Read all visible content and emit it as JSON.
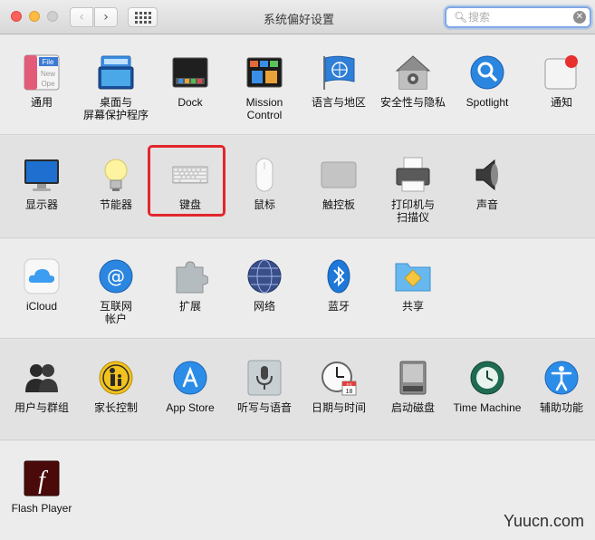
{
  "window": {
    "title": "系统偏好设置",
    "back_glyph": "‹",
    "forward_glyph": "›"
  },
  "search": {
    "placeholder": "搜索",
    "value": ""
  },
  "rows": [
    [
      {
        "label": "通用",
        "icon": "general-icon"
      },
      {
        "label": "桌面与\n屏幕保护程序",
        "icon": "desktop-screensaver-icon"
      },
      {
        "label": "Dock",
        "icon": "dock-icon"
      },
      {
        "label": "Mission\nControl",
        "icon": "mission-control-icon"
      },
      {
        "label": "语言与地区",
        "icon": "language-region-icon"
      },
      {
        "label": "安全性与隐私",
        "icon": "security-privacy-icon"
      },
      {
        "label": "Spotlight",
        "icon": "spotlight-icon"
      },
      {
        "label": "通知",
        "icon": "notifications-icon"
      }
    ],
    [
      {
        "label": "显示器",
        "icon": "displays-icon"
      },
      {
        "label": "节能器",
        "icon": "energy-saver-icon"
      },
      {
        "label": "键盘",
        "icon": "keyboard-icon"
      },
      {
        "label": "鼠标",
        "icon": "mouse-icon"
      },
      {
        "label": "触控板",
        "icon": "trackpad-icon"
      },
      {
        "label": "打印机与\n扫描仪",
        "icon": "printers-scanners-icon"
      },
      {
        "label": "声音",
        "icon": "sound-icon"
      }
    ],
    [
      {
        "label": "iCloud",
        "icon": "icloud-icon"
      },
      {
        "label": "互联网\n帐户",
        "icon": "internet-accounts-icon"
      },
      {
        "label": "扩展",
        "icon": "extensions-icon"
      },
      {
        "label": "网络",
        "icon": "network-icon"
      },
      {
        "label": "蓝牙",
        "icon": "bluetooth-icon"
      },
      {
        "label": "共享",
        "icon": "sharing-icon"
      }
    ],
    [
      {
        "label": "用户与群组",
        "icon": "users-groups-icon"
      },
      {
        "label": "家长控制",
        "icon": "parental-controls-icon"
      },
      {
        "label": "App Store",
        "icon": "app-store-icon"
      },
      {
        "label": "听写与语音",
        "icon": "dictation-speech-icon"
      },
      {
        "label": "日期与时间",
        "icon": "date-time-icon"
      },
      {
        "label": "启动磁盘",
        "icon": "startup-disk-icon"
      },
      {
        "label": "Time Machine",
        "icon": "time-machine-icon"
      },
      {
        "label": "辅助功能",
        "icon": "accessibility-icon"
      }
    ],
    [
      {
        "label": "Flash Player",
        "icon": "flash-player-icon"
      }
    ]
  ],
  "icon_text": {
    "general_tab": "File",
    "general_line1": "New",
    "general_line2": "Ope",
    "calendar_month": "JUL",
    "calendar_day": "18",
    "flash_glyph": "f"
  },
  "highlighted_pane": "键盘",
  "watermark": "Yuucn.com"
}
